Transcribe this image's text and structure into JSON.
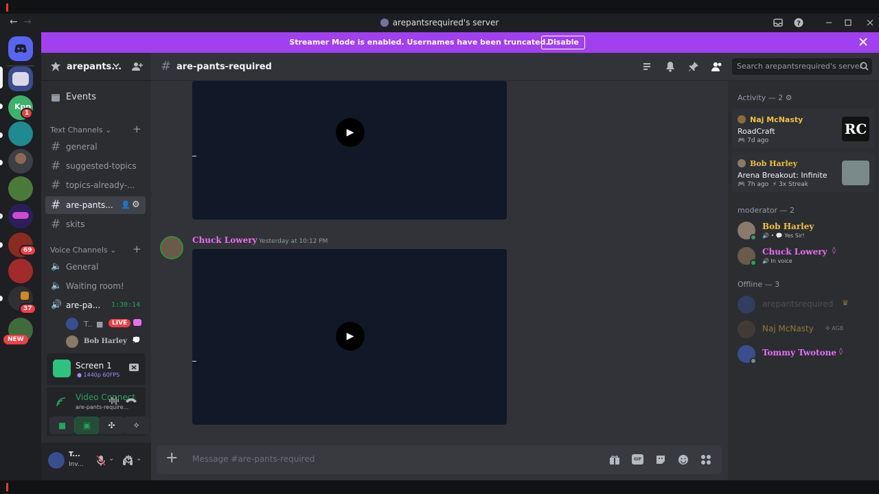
{
  "window": {
    "title": "arepantsrequired's server",
    "back": "←",
    "forward": "→"
  },
  "banner": {
    "text": "Streamer Mode is enabled. Usernames have been truncated.",
    "button": "Disable",
    "color": "#a140f0"
  },
  "rail": {
    "badges": [
      "1",
      "69",
      "37"
    ],
    "new_label": "NEW"
  },
  "sidebar": {
    "server_name": "arepants...",
    "events": "Events",
    "text_category": "Text Channels",
    "text_channels": [
      "general",
      "suggested-topics",
      "topics-already-...",
      "are-pants...",
      "skits"
    ],
    "voice_category": "Voice Channels",
    "voice_channels": [
      "General",
      "Waiting room!",
      "are-pa..."
    ],
    "voice_timer": "1:30:14",
    "voice_users": [
      {
        "name": "T..",
        "live": "LIVE"
      },
      {
        "name": "Bob Harley"
      }
    ]
  },
  "screen_panel": {
    "title": "Screen 1",
    "quality": "1440p 60FPS"
  },
  "voice_panel": {
    "status": "Video Connected",
    "channel": "are-pants-require..."
  },
  "user_panel": {
    "name": "T...",
    "status": "Inv..."
  },
  "main": {
    "channel": "are-pants-required",
    "message": {
      "author": "Chuck Lowery",
      "time": "Yesterday at 10:12 PM",
      "author_color": "#e86ff5"
    },
    "composer_placeholder": "Message #are-pants-required"
  },
  "search": {
    "placeholder": "Search arepantsrequired's server"
  },
  "members": {
    "activity_header": "Activity — 2",
    "activity": [
      {
        "name": "Naj McNasty",
        "game": "RoadCraft",
        "time": "7d ago",
        "art": "RC"
      },
      {
        "name": "Bob Harley",
        "game": "Arena Breakout: Infinite",
        "time": "7h ago",
        "streak": "3x Streak"
      }
    ],
    "moderator_header": "moderator — 2",
    "moderators": [
      {
        "name": "Bob Harley",
        "status": "Yes Sir!",
        "color": "#f0c040"
      },
      {
        "name": "Chuck Lowery",
        "status": "In voice",
        "color": "#e86ff5"
      }
    ],
    "offline_header": "Offline — 3",
    "offline": [
      {
        "name": "arepantsrequired",
        "color": "#6d6f78"
      },
      {
        "name": "Naj McNasty",
        "tag": "AGB",
        "color": "#7a7040"
      },
      {
        "name": "Tommy Twotone",
        "color": "#e86ff5"
      }
    ]
  }
}
